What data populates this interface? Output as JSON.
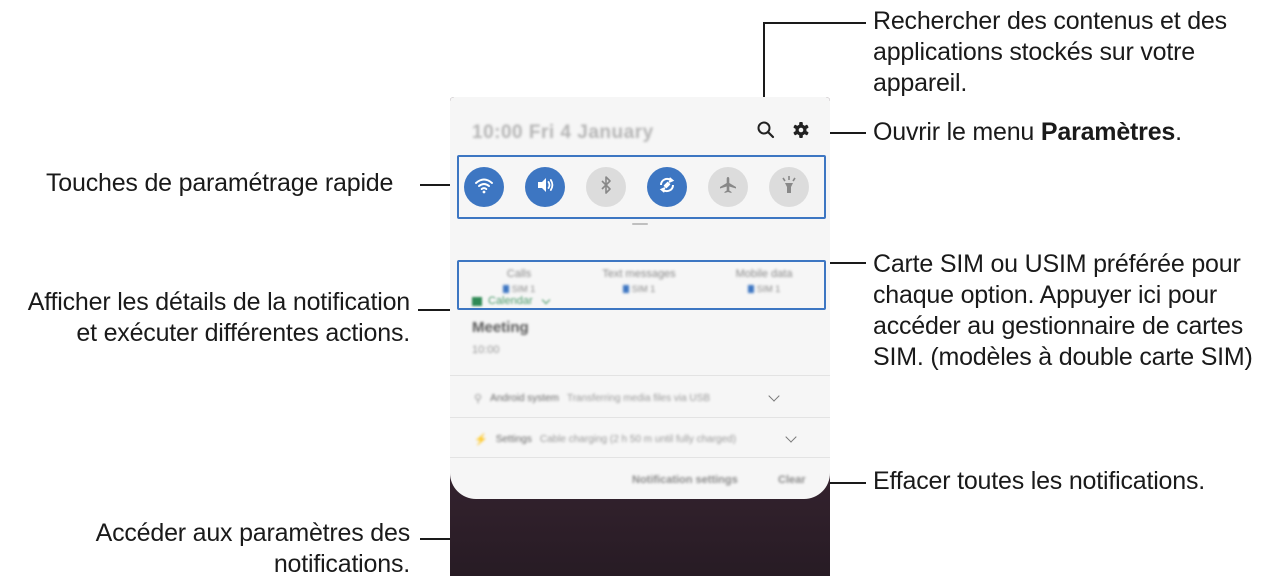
{
  "callouts": {
    "search_line1": "Rechercher des contenus et des",
    "search_line2": "applications stockés sur votre",
    "search_line3": "appareil.",
    "settings_prefix": "Ouvrir le menu ",
    "settings_bold": "Paramètres",
    "settings_suffix": ".",
    "quick_settings": "Touches de paramétrage rapide",
    "details_line1": "Afficher les détails de la notification",
    "details_line2": "et exécuter différentes actions.",
    "sim_line1": "Carte SIM ou USIM préférée pour",
    "sim_line2": "chaque option. Appuyer ici pour",
    "sim_line3": "accéder au gestionnaire de cartes",
    "sim_line4": "SIM. (modèles à double carte SIM)",
    "clear": "Effacer toutes les notifications.",
    "notif_settings_line1": "Accéder aux paramètres des",
    "notif_settings_line2": "notifications."
  },
  "panel": {
    "datetime": "10:00 Fri 4 January",
    "quick_tiles": [
      {
        "icon": "wifi-icon",
        "state": "on"
      },
      {
        "icon": "sound-icon",
        "state": "on"
      },
      {
        "icon": "bluetooth-icon",
        "state": "off"
      },
      {
        "icon": "auto-rotate-icon",
        "state": "on"
      },
      {
        "icon": "airplane-icon",
        "state": "off"
      },
      {
        "icon": "flashlight-icon",
        "state": "off"
      }
    ],
    "sim": [
      {
        "name": "Calls",
        "slot": "SIM 1"
      },
      {
        "name": "Text messages",
        "slot": "SIM 1"
      },
      {
        "name": "Mobile data",
        "slot": "SIM 1"
      }
    ],
    "calendar_app": "Calendar",
    "calendar_title": "Meeting",
    "calendar_time": "10:00",
    "notif1_app": "Android system",
    "notif1_text": "Transferring media files via USB",
    "notif2_app": "Settings",
    "notif2_text": "Cable charging (2 h 50 m until fully charged)",
    "footer_settings": "Notification settings",
    "footer_clear": "Clear"
  },
  "colors": {
    "accent": "#3d76c2",
    "panel_bg": "#f6f6f6",
    "wallpaper": "#3e2a36"
  }
}
